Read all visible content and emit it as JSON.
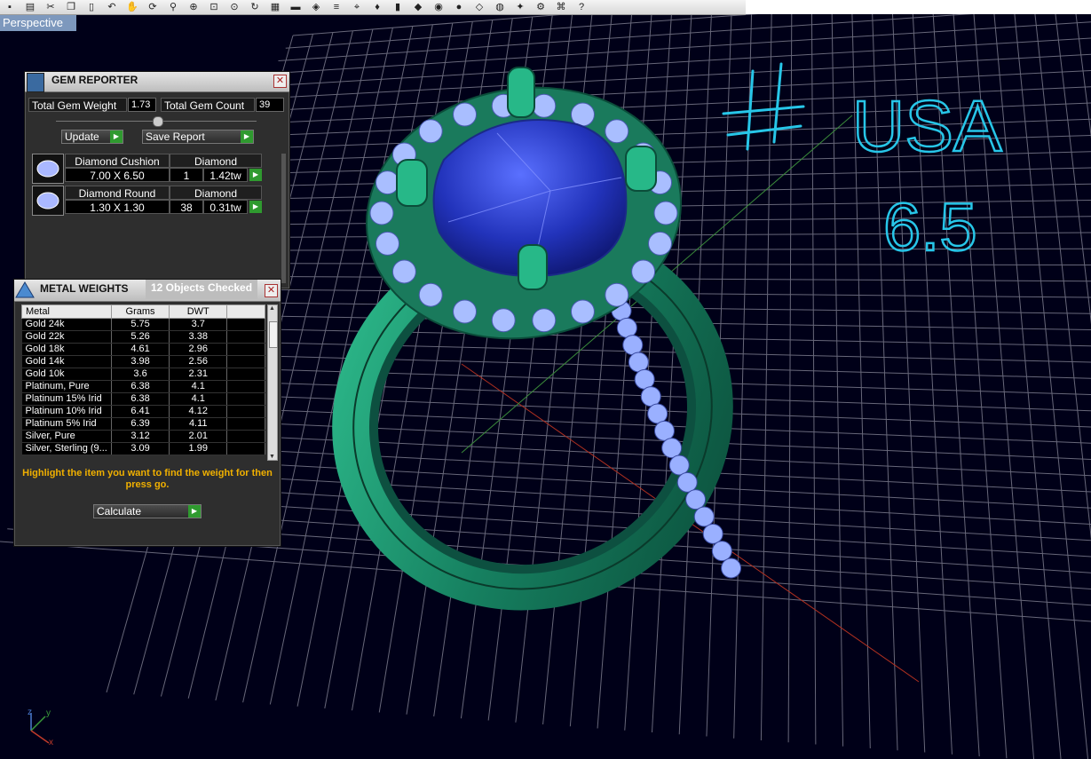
{
  "toolbar": {
    "icons": [
      "save-icon",
      "print-icon",
      "cut-icon",
      "copy-icon",
      "paste-icon",
      "undo-icon",
      "pan-icon",
      "rotate-icon",
      "zoom-icon",
      "zoom-window-icon",
      "zoom-extents-icon",
      "zoom-selected-icon",
      "rotate-view-icon",
      "grid-icon",
      "car-icon",
      "render-icon",
      "layers-icon",
      "snap-icon",
      "light-icon",
      "trash-icon",
      "shading-icon",
      "color-wheel-icon",
      "sphere-icon",
      "gem-icon",
      "material-icon",
      "wand-icon",
      "settings-icon",
      "network-icon",
      "help-icon"
    ]
  },
  "viewport": {
    "label": "Perspective"
  },
  "annotation": {
    "hash": "#",
    "country": "USA",
    "size": "6.5"
  },
  "gem_reporter": {
    "title": "GEM REPORTER",
    "total_weight_label": "Total Gem Weight",
    "total_weight_value": "1.73",
    "total_count_label": "Total Gem Count",
    "total_count_value": "39",
    "update_label": "Update",
    "save_report_label": "Save Report",
    "gems": [
      {
        "name": "Diamond Cushion",
        "type": "Diamond",
        "size": "7.00 X 6.50",
        "count": "1",
        "weight": "1.42tw"
      },
      {
        "name": "Diamond Round",
        "type": "Diamond",
        "size": "1.30 X 1.30",
        "count": "38",
        "weight": "0.31tw"
      }
    ]
  },
  "metal_weights": {
    "title": "METAL WEIGHTS",
    "status": "12 Objects Checked",
    "columns": [
      "Metal",
      "Grams",
      "DWT"
    ],
    "rows": [
      [
        "Gold 24k",
        "5.75",
        "3.7"
      ],
      [
        "Gold 22k",
        "5.26",
        "3.38"
      ],
      [
        "Gold 18k",
        "4.61",
        "2.96"
      ],
      [
        "Gold 14k",
        "3.98",
        "2.56"
      ],
      [
        "Gold 10k",
        "3.6",
        "2.31"
      ],
      [
        "Platinum, Pure",
        "6.38",
        "4.1"
      ],
      [
        "Platinum 15% Irid",
        "6.38",
        "4.1"
      ],
      [
        "Platinum 10% Irid",
        "6.41",
        "4.12"
      ],
      [
        "Platinum 5% Irid",
        "6.39",
        "4.11"
      ],
      [
        "Silver, Pure",
        "3.12",
        "2.01"
      ],
      [
        "Silver, Sterling (9...",
        "3.09",
        "1.99"
      ]
    ],
    "hint": "Highlight the item you want to find the weight for then press go.",
    "calculate_label": "Calculate"
  },
  "axes": {
    "x": "x",
    "y": "y",
    "z": "z"
  },
  "colors": {
    "background": "#000018",
    "grid": "#8a8a9a",
    "ring": "#1e8a6a",
    "center_stone": "#2838c8",
    "accent_stone": "#8fa8ff",
    "annotation": "#27c6e8",
    "go_button": "#2f9a2f",
    "hint": "#f0b000"
  }
}
